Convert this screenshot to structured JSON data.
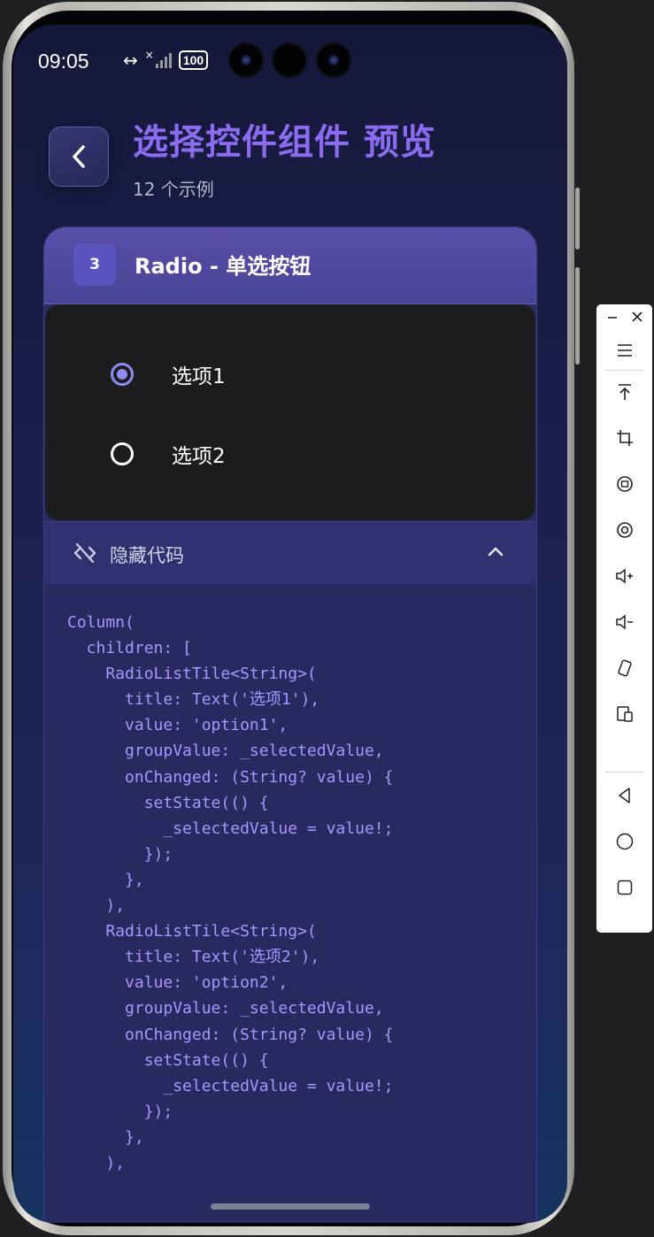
{
  "status_bar": {
    "time": "09:05",
    "data_icon": "↔",
    "signal_x": "×",
    "battery": "100"
  },
  "header": {
    "title": "选择控件组件 预览",
    "subtitle": "12 个示例"
  },
  "card": {
    "number": "3",
    "title": "Radio - 单选按钮",
    "radio_options": [
      {
        "label": "选项1",
        "selected": true
      },
      {
        "label": "选项2",
        "selected": false
      }
    ],
    "code_toggle_label": "隐藏代码",
    "code": "Column(\n  children: [\n    RadioListTile<String>(\n      title: Text('选项1'),\n      value: 'option1',\n      groupValue: _selectedValue,\n      onChanged: (String? value) {\n        setState(() {\n          _selectedValue = value!;\n        });\n      },\n    ),\n    RadioListTile<String>(\n      title: Text('选项2'),\n      value: 'option2',\n      groupValue: _selectedValue,\n      onChanged: (String? value) {\n        setState(() {\n          _selectedValue = value!;\n        });\n      },\n    ),"
  },
  "colors": {
    "accent": "#8b6cf0",
    "radio_selected": "#8f8bf0",
    "code_text": "#a996ff"
  },
  "toolbar_icons": [
    "minimize-icon",
    "close-icon",
    "menu-icon",
    "pin-top-icon",
    "crop-icon",
    "rotate-icon",
    "screen-record-icon",
    "volume-up-icon",
    "volume-down-icon",
    "rotate-device-icon",
    "devices-icon",
    "back-nav-icon",
    "home-nav-icon",
    "recents-nav-icon"
  ]
}
